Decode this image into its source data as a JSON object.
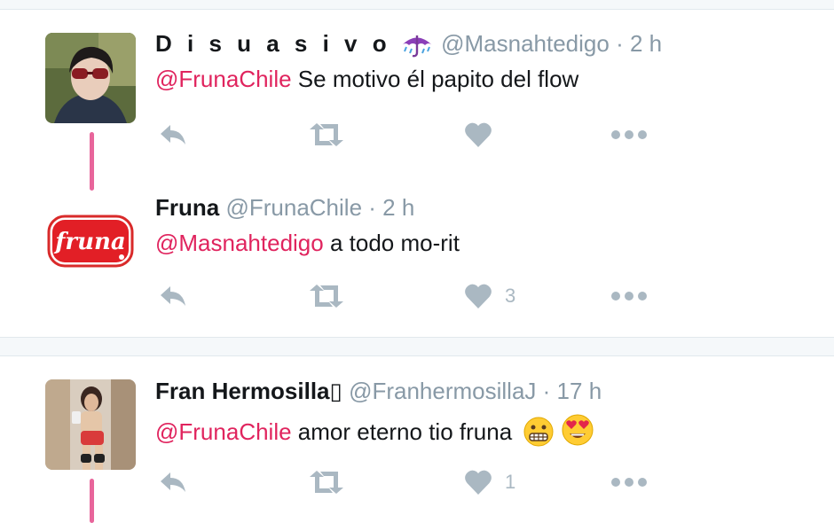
{
  "colors": {
    "mention": "#e0245e",
    "thread_line": "#e8659b",
    "icon_gray": "#aab8c2",
    "meta_gray": "#8899a6"
  },
  "tweets": [
    {
      "name": "D i s u a s i v o",
      "name_emoji": "umbrella-icon",
      "handle": "@Masnahtedigo",
      "sep": "·",
      "time": "2 h",
      "mention": "@FrunaChile",
      "text": "Se motivo él papito del flow",
      "reply_icon": "reply-icon",
      "retweet_icon": "retweet-icon",
      "like_icon": "heart-icon",
      "like_count": "",
      "more_icon": "more-dots-icon"
    },
    {
      "name": "Fruna",
      "handle": "@FrunaChile",
      "sep": "·",
      "time": "2 h",
      "mention": "@Masnahtedigo",
      "text": "a todo mo-rit",
      "logo_text": "fruna",
      "reply_icon": "reply-icon",
      "retweet_icon": "retweet-icon",
      "like_icon": "heart-icon",
      "like_count": "3",
      "more_icon": "more-dots-icon"
    },
    {
      "name": "Fran Hermosilla",
      "name_suffix": "▯",
      "handle": "@FranhermosillaJ",
      "sep": "·",
      "time": "17 h",
      "mention": "@FrunaChile",
      "text": "amor eterno tio fruna",
      "emojis": [
        "grimacing-face-icon",
        "heart-eyes-face-icon"
      ],
      "reply_icon": "reply-icon",
      "retweet_icon": "retweet-icon",
      "like_icon": "heart-icon",
      "like_count": "1",
      "more_icon": "more-dots-icon"
    }
  ]
}
